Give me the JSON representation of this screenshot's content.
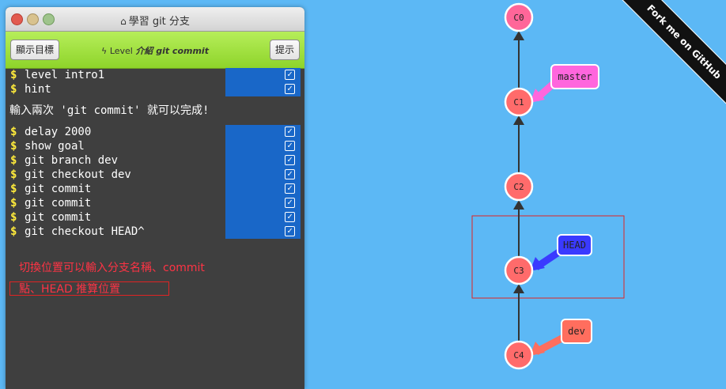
{
  "window": {
    "title": "學習 git 分支"
  },
  "toolbar": {
    "goal_label": "顯示目標",
    "hint_label": "提示",
    "level_prefix": "Level",
    "level_name": "介紹 git commit"
  },
  "terminal": {
    "lines_top": [
      {
        "cmd": "level intro1"
      },
      {
        "cmd": "hint"
      }
    ],
    "message": "輸入兩次 'git commit' 就可以完成!",
    "lines_bottom": [
      {
        "cmd": "delay 2000"
      },
      {
        "cmd": "show goal"
      },
      {
        "cmd": "git branch dev"
      },
      {
        "cmd": "git checkout dev"
      },
      {
        "cmd": "git commit"
      },
      {
        "cmd": "git commit"
      },
      {
        "cmd": "git commit"
      },
      {
        "cmd": "git checkout HEAD^"
      }
    ],
    "prompt": "$",
    "note_line1": "切換位置可以輸入分支名稱、commit",
    "note_line2": "點、HEAD 推算位置"
  },
  "ribbon": {
    "text": "Fork me on GitHub"
  },
  "graph": {
    "commits": [
      "C0",
      "C1",
      "C2",
      "C3",
      "C4"
    ],
    "branches": [
      {
        "name": "master",
        "target": "C1",
        "color": "#ff66dd"
      },
      {
        "name": "HEAD",
        "target": "C3",
        "color": "#3a3aff"
      },
      {
        "name": "dev",
        "target": "C4",
        "color": "#ff6e5e"
      }
    ],
    "colors": {
      "commit_fill": "#ff6b6b",
      "root_fill": "#ff6699",
      "background": "#5cb8f5"
    }
  }
}
